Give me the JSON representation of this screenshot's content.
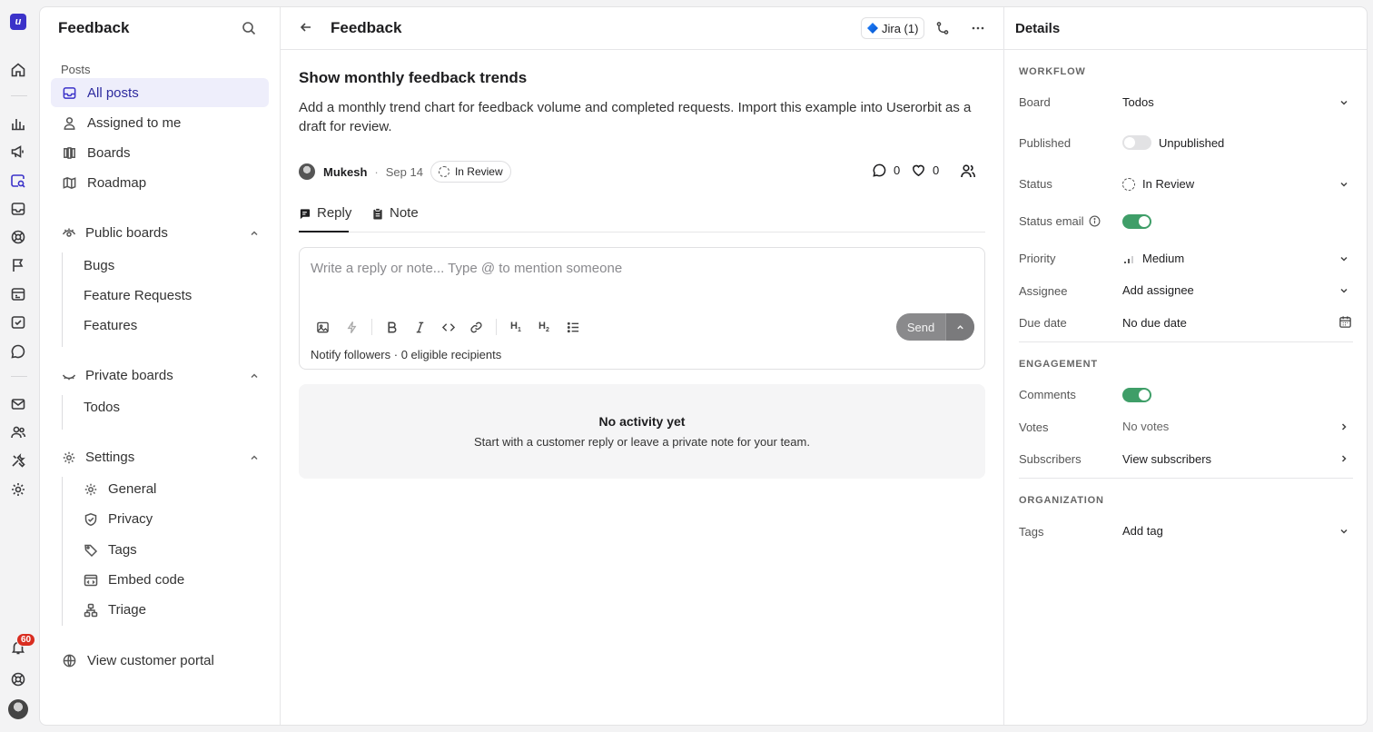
{
  "rail": {
    "logo_letter": "u",
    "notification_count": "60",
    "icons": [
      "home-icon",
      "chart-icon",
      "megaphone-icon",
      "feedback-search-icon",
      "inbox-icon",
      "support-icon",
      "flag-icon",
      "browser-icon",
      "checklist-icon",
      "chat-icon",
      "mail-icon",
      "users-icon",
      "tools-icon",
      "gear-icon",
      "bell-icon",
      "help-icon"
    ]
  },
  "sidebar": {
    "title": "Feedback",
    "section_label": "Posts",
    "items": [
      {
        "label": "All posts",
        "icon": "inbox-icon"
      },
      {
        "label": "Assigned to me",
        "icon": "user-icon"
      },
      {
        "label": "Boards",
        "icon": "boards-icon"
      },
      {
        "label": "Roadmap",
        "icon": "map-icon"
      }
    ],
    "public_boards": {
      "label": "Public boards",
      "items": [
        "Bugs",
        "Feature Requests",
        "Features"
      ]
    },
    "private_boards": {
      "label": "Private boards",
      "items": [
        "Todos"
      ]
    },
    "settings": {
      "label": "Settings",
      "items": [
        {
          "label": "General",
          "icon": "gear-icon"
        },
        {
          "label": "Privacy",
          "icon": "shield-icon"
        },
        {
          "label": "Tags",
          "icon": "tag-icon"
        },
        {
          "label": "Embed code",
          "icon": "embed-icon"
        },
        {
          "label": "Triage",
          "icon": "triage-icon"
        }
      ]
    },
    "portal_link": "View customer portal"
  },
  "main": {
    "title": "Feedback",
    "jira_label": "Jira (1)",
    "post": {
      "title": "Show monthly feedback trends",
      "body": "Add a monthly trend chart for feedback volume and completed requests. Import this example into Userorbit as a draft for review.",
      "author": "Mukesh",
      "date": "Sep 14",
      "status": "In Review",
      "comments": "0",
      "likes": "0"
    },
    "tabs": [
      {
        "label": "Reply",
        "icon": "reply-icon"
      },
      {
        "label": "Note",
        "icon": "note-icon"
      }
    ],
    "composer": {
      "placeholder": "Write a reply or note... Type @ to mention someone",
      "send_label": "Send",
      "footer": "Notify followers · 0 eligible recipients",
      "toolbar": [
        "image-icon",
        "ai-icon",
        "bold-icon",
        "italic-icon",
        "code-icon",
        "link-icon",
        "heading1-icon",
        "heading2-icon",
        "list-icon"
      ]
    },
    "activity": {
      "title": "No activity yet",
      "subtitle": "Start with a customer reply or leave a private note for your team."
    }
  },
  "details": {
    "title": "Details",
    "workflow_label": "WORKFLOW",
    "engagement_label": "ENGAGEMENT",
    "organization_label": "ORGANIZATION",
    "board": {
      "label": "Board",
      "value": "Todos"
    },
    "published": {
      "label": "Published",
      "value": "Unpublished",
      "on": false
    },
    "status": {
      "label": "Status",
      "value": "In Review"
    },
    "status_email": {
      "label": "Status email",
      "on": true
    },
    "priority": {
      "label": "Priority",
      "value": "Medium"
    },
    "assignee": {
      "label": "Assignee",
      "value": "Add assignee"
    },
    "due_date": {
      "label": "Due date",
      "value": "No due date"
    },
    "comments": {
      "label": "Comments",
      "on": true
    },
    "votes": {
      "label": "Votes",
      "value": "No votes"
    },
    "subscribers": {
      "label": "Subscribers",
      "value": "View subscribers"
    },
    "tags": {
      "label": "Tags",
      "value": "Add tag"
    }
  },
  "colors": {
    "accent": "#3b32c9",
    "toggle_on": "#3f9e68",
    "badge": "#d92d20"
  }
}
